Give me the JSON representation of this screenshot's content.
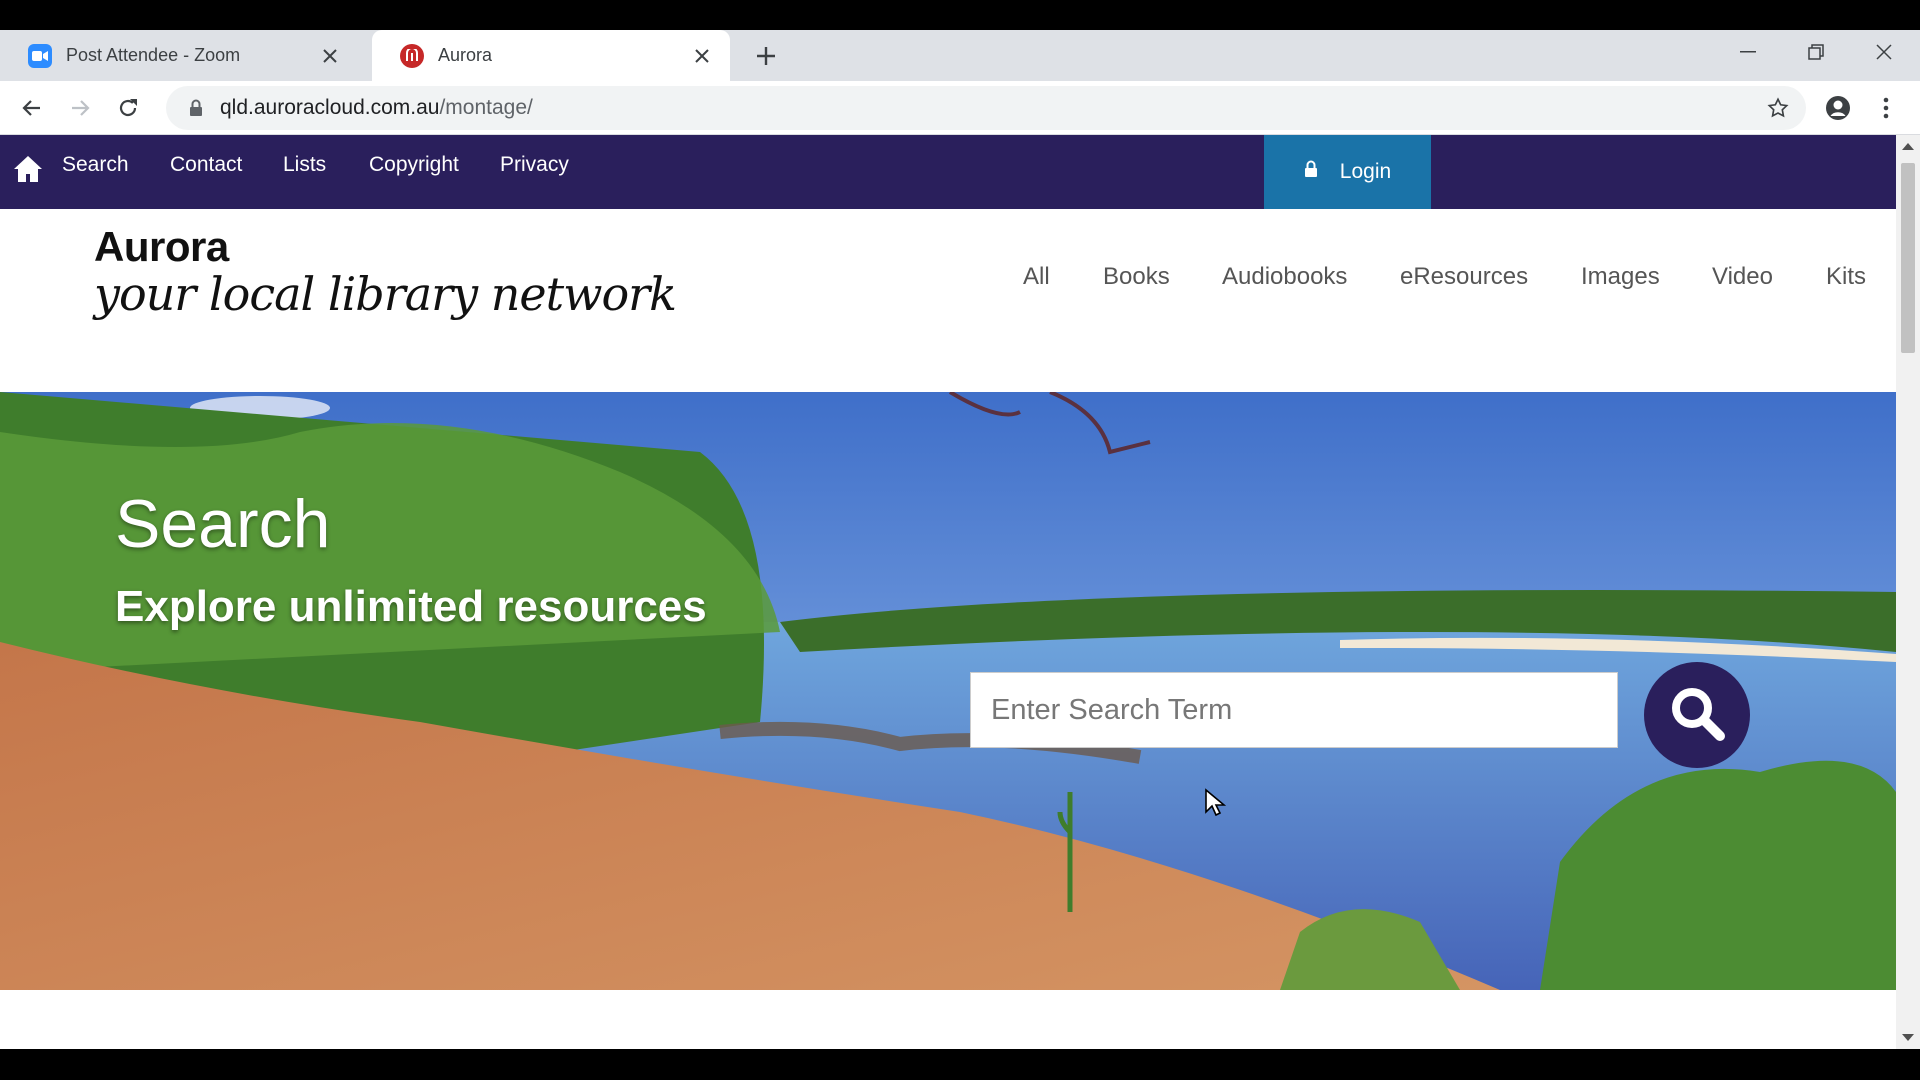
{
  "browser": {
    "tabs": [
      {
        "title": "Post Attendee - Zoom",
        "active": false,
        "favicon": "zoom-icon"
      },
      {
        "title": "Aurora",
        "active": true,
        "favicon": "aurora-icon"
      }
    ],
    "url_host": "qld.auroracloud.com.au",
    "url_path": "/montage/"
  },
  "site": {
    "topnav": [
      "Search",
      "Contact",
      "Lists",
      "Copyright",
      "Privacy"
    ],
    "login_label": "Login",
    "brand_name": "Aurora",
    "brand_tagline": "your local library network",
    "categories": [
      "All",
      "Books",
      "Audiobooks",
      "eResources",
      "Images",
      "Video",
      "Kits"
    ]
  },
  "hero": {
    "title": "Search",
    "subtitle": "Explore unlimited resources",
    "search_placeholder": "Enter Search Term"
  },
  "colors": {
    "nav_bg": "#2a1f5c",
    "login_bg": "#1a73a8",
    "search_button_bg": "#2a1f5c"
  }
}
